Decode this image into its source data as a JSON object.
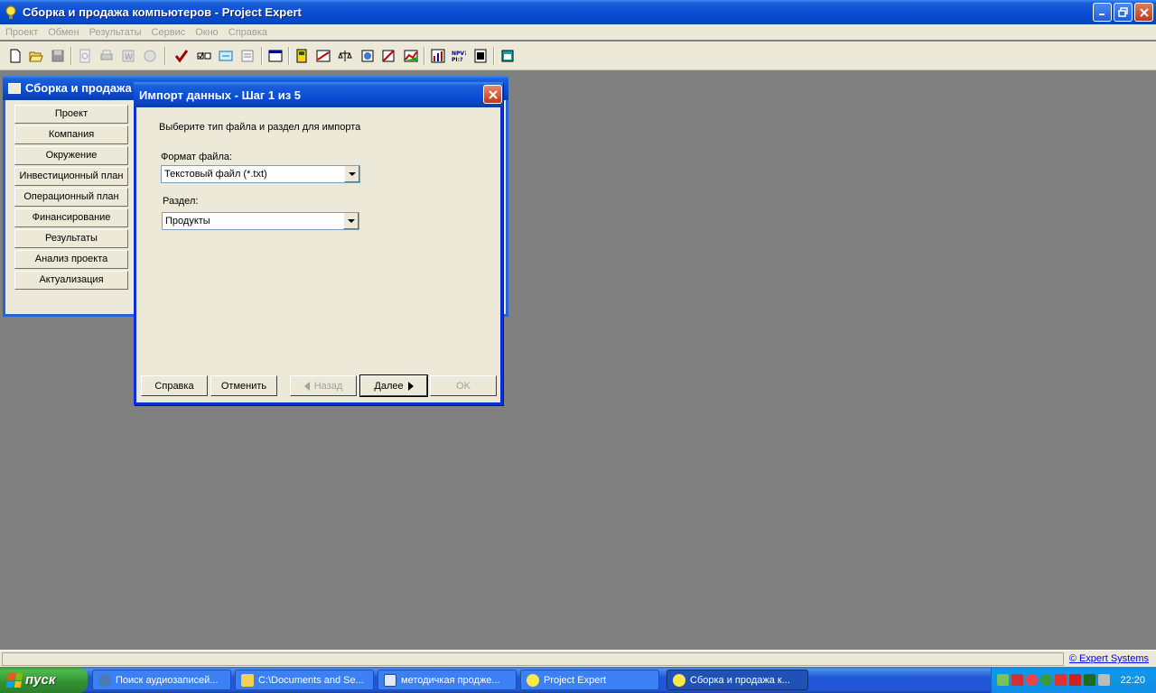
{
  "app": {
    "title": "Сборка и продажа компьютеров - Project Expert"
  },
  "menu": [
    "Проект",
    "Обмен",
    "Результаты",
    "Сервис",
    "Окно",
    "Справка"
  ],
  "project_window": {
    "title": "Сборка и продажа",
    "nav": [
      "Проект",
      "Компания",
      "Окружение",
      "Инвестиционный план",
      "Операционный план",
      "Финансирование",
      "Результаты",
      "Анализ проекта",
      "Актуализация"
    ]
  },
  "dialog": {
    "title": "Импорт данных - Шаг 1 из 5",
    "instruction": "Выберите тип файла и раздел для импорта",
    "format_label": "Формат файла:",
    "format_value": "Текстовый файл (*.txt)",
    "section_label": "Раздел:",
    "section_value": "Продукты",
    "buttons": {
      "help": "Справка",
      "cancel": "Отменить",
      "back": "Назад",
      "next": "Далее",
      "ok": "OK"
    }
  },
  "statusbar": {
    "copyright": "© Expert Systems"
  },
  "taskbar": {
    "start": "пуск",
    "tasks": [
      {
        "label": "Поиск аудиозаписей...",
        "active": false
      },
      {
        "label": "C:\\Documents and Se...",
        "active": false
      },
      {
        "label": "методичкая продже...",
        "active": false
      },
      {
        "label": "Project Expert",
        "active": false
      },
      {
        "label": "Сборка и продажа к...",
        "active": true
      }
    ],
    "clock": "22:20"
  }
}
